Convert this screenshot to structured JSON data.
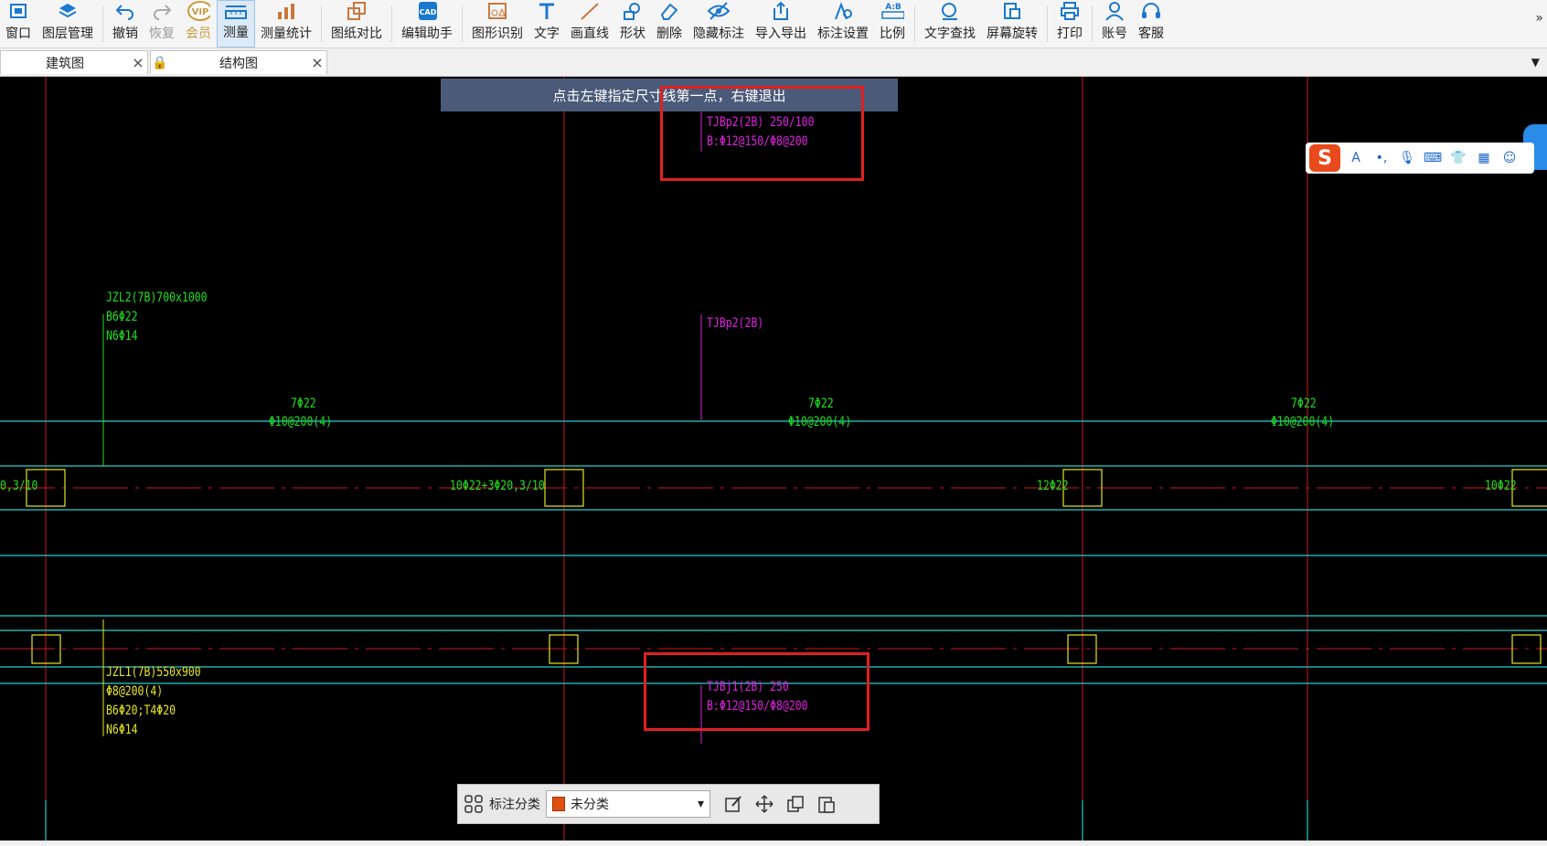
{
  "toolbar": {
    "items": [
      {
        "label": "窗口",
        "icon": "window-icon"
      },
      {
        "label": "图层管理",
        "icon": "layers-icon"
      },
      {
        "label": "撤销",
        "icon": "undo-icon"
      },
      {
        "label": "恢复",
        "icon": "redo-icon"
      },
      {
        "label": "会员",
        "icon": "vip-icon",
        "badge": "VIP"
      },
      {
        "label": "测量",
        "icon": "measure-icon"
      },
      {
        "label": "测量统计",
        "icon": "measure-stats-icon"
      },
      {
        "label": "图纸对比",
        "icon": "compare-icon"
      },
      {
        "label": "编辑助手",
        "icon": "cad-edit-icon",
        "badge": "CAD"
      },
      {
        "label": "图形识别",
        "icon": "shape-recognition-icon"
      },
      {
        "label": "文字",
        "icon": "text-icon"
      },
      {
        "label": "画直线",
        "icon": "line-icon"
      },
      {
        "label": "形状",
        "icon": "shape-icon"
      },
      {
        "label": "删除",
        "icon": "eraser-icon"
      },
      {
        "label": "隐藏标注",
        "icon": "hide-eye-icon"
      },
      {
        "label": "导入导出",
        "icon": "import-export-icon"
      },
      {
        "label": "标注设置",
        "icon": "annotation-settings-icon"
      },
      {
        "label": "比例",
        "icon": "scale-icon",
        "badge": "A:B"
      },
      {
        "label": "文字查找",
        "icon": "text-search-icon"
      },
      {
        "label": "屏幕旋转",
        "icon": "rotate-icon"
      },
      {
        "label": "打印",
        "icon": "print-icon"
      },
      {
        "label": "账号",
        "icon": "account-icon"
      },
      {
        "label": "客服",
        "icon": "headset-icon"
      }
    ],
    "more": "»"
  },
  "tabs": [
    {
      "label": "建筑图",
      "close": "×"
    },
    {
      "label": "结构图",
      "close": "×"
    }
  ],
  "hint": "点击左键指定尺寸线第一点，右键退出",
  "annotations": {
    "tjbp2_top_1": "TJBp2(2B) 250/100",
    "tjbp2_top_2": "B:Φ12@150/Φ8@200",
    "tjbp2_mid": "TJBp2(2B)",
    "jzl2_1": "JZL2(7B)700x1000",
    "jzl2_2": "B6Φ22",
    "jzl2_3": "N6Φ14",
    "rebar_top_a": "7Φ22",
    "stirrup_a": "Φ10@200(4)",
    "rebar_top_b": "7Φ22",
    "stirrup_b": "Φ10@200(4)",
    "rebar_top_c": "7Φ22",
    "stirrup_c": "Φ10@200(4)",
    "rebar_bot_a": "0,3/10",
    "rebar_bot_b": "10Φ22+3Φ20,3/10",
    "rebar_bot_c": "12Φ22",
    "rebar_bot_d": "10Φ22",
    "jzl1_1": "JZL1(7B)550x900",
    "jzl1_2": "Φ8@200(4)",
    "jzl1_3": "B6Φ20;T4Φ20",
    "jzl1_4": "N6Φ14",
    "tjbj1_1": "TJBj1(2B) 250",
    "tjbj1_2": "B:Φ12@150/Φ8@200"
  },
  "ime": {
    "logo": "S",
    "items": [
      "A",
      "•,",
      "mic-icon",
      "keyboard-icon",
      "shirt-icon",
      "grid-icon",
      "avatar-icon"
    ]
  },
  "bottom_panel": {
    "label": "标注分类",
    "select_value": "未分类",
    "swatch_color": "#e05010"
  },
  "colors": {
    "axis": "#d01818",
    "beam": "#20d0d0",
    "column": "#e6e620",
    "magenta": "#e020e0",
    "green": "#20e020",
    "hint_bg": "#4a5a78"
  }
}
